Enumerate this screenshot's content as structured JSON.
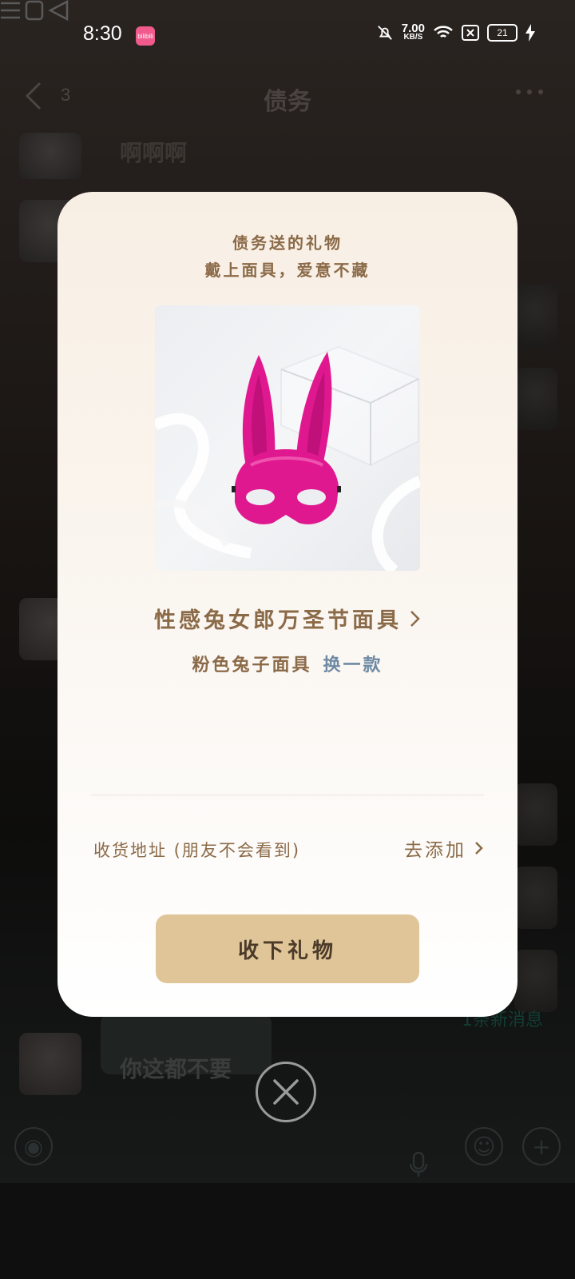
{
  "status_bar": {
    "time": "8:30",
    "app_badge": "bilibili",
    "net_speed_value": "7.00",
    "net_speed_unit": "KB/S",
    "battery": "21"
  },
  "chat": {
    "unread_count": "3",
    "title": "债务",
    "messages": [
      {
        "text": "啊啊啊"
      },
      {
        "text": "你这都不要"
      }
    ],
    "new_message_hint": "1条新消息"
  },
  "gift_modal": {
    "from_text": "债务送的礼物",
    "slogan": "戴上面具，爱意不藏",
    "gift_name": "性感兔女郎万圣节面具",
    "variant": "粉色兔子面具",
    "change_label": "换一款",
    "address_label": "收货地址 (朋友不会看到)",
    "address_action": "去添加",
    "accept_label": "收下礼物",
    "colors": {
      "accent_text": "#8b6a48",
      "button": "#dfc597",
      "link": "#6f8aa3",
      "mask": "#e0188f"
    }
  },
  "icons": {
    "back": "chevron-left-icon",
    "more": "more-dots-icon",
    "close": "close-circle-icon",
    "voice": "voice-icon",
    "mic": "mic-icon",
    "emoji": "emoji-icon",
    "add": "plus-icon"
  }
}
